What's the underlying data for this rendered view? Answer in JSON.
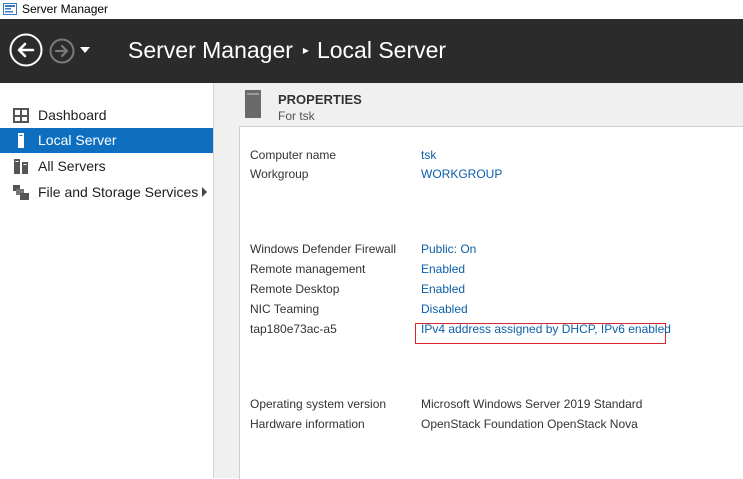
{
  "window": {
    "title": "Server Manager"
  },
  "header": {
    "breadcrumb_root": "Server Manager",
    "breadcrumb_separator": "▸",
    "breadcrumb_current": "Local Server"
  },
  "sidebar": {
    "items": [
      {
        "label": "Dashboard",
        "icon": "dashboard-icon",
        "active": false
      },
      {
        "label": "Local Server",
        "icon": "server-icon",
        "active": true
      },
      {
        "label": "All Servers",
        "icon": "servers-icon",
        "active": false
      },
      {
        "label": "File and Storage Services",
        "icon": "storage-icon",
        "active": false,
        "has_submenu": true
      }
    ]
  },
  "properties": {
    "title": "PROPERTIES",
    "subtitle": "For tsk",
    "rows": [
      {
        "label": "Computer name",
        "value": "tsk",
        "link": true
      },
      {
        "label": "Workgroup",
        "value": "WORKGROUP",
        "link": true
      },
      {
        "label": "Windows Defender Firewall",
        "value": "Public: On",
        "link": true
      },
      {
        "label": "Remote management",
        "value": "Enabled",
        "link": true
      },
      {
        "label": "Remote Desktop",
        "value": "Enabled",
        "link": true
      },
      {
        "label": "NIC Teaming",
        "value": "Disabled",
        "link": true
      },
      {
        "label": "tap180e73ac-a5",
        "value": "IPv4 address assigned by DHCP, IPv6 enabled",
        "link": true,
        "highlighted": true
      },
      {
        "label": "Operating system version",
        "value": "Microsoft Windows Server 2019 Standard",
        "link": false
      },
      {
        "label": "Hardware information",
        "value": "OpenStack Foundation OpenStack Nova",
        "link": false
      }
    ]
  },
  "colors": {
    "header_bg": "#2b2b2b",
    "active_item": "#0e6fc1",
    "link": "#0b5fa8",
    "highlight_border": "#d9282f"
  }
}
